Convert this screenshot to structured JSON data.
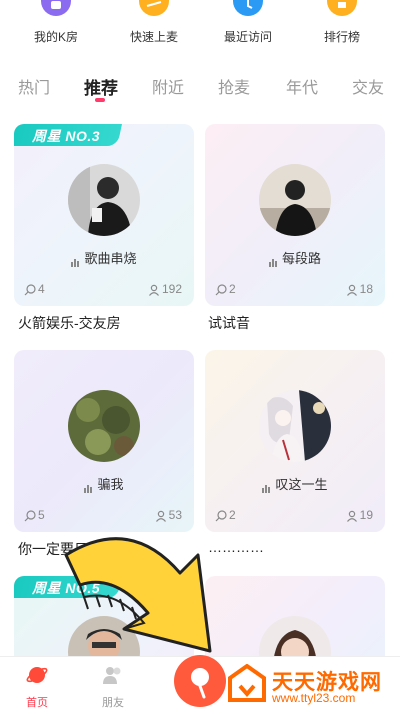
{
  "quick_entries": [
    {
      "label": "我的K房",
      "icon": "my-room-icon",
      "color": "#8b6cf0"
    },
    {
      "label": "快速上麦",
      "icon": "quick-mic-icon",
      "color": "#ffb020"
    },
    {
      "label": "最近访问",
      "icon": "recent-visit-icon",
      "color": "#2b9af5"
    },
    {
      "label": "排行榜",
      "icon": "leaderboard-icon",
      "color": "#ffb020"
    }
  ],
  "tabs": [
    {
      "label": "热门",
      "active": false
    },
    {
      "label": "推荐",
      "active": true
    },
    {
      "label": "附近",
      "active": false
    },
    {
      "label": "抢麦",
      "active": false
    },
    {
      "label": "年代",
      "active": false
    },
    {
      "label": "交友",
      "active": false
    }
  ],
  "rooms": [
    {
      "badge": "周星 NO.3",
      "song": "歌曲串烧",
      "comments": "4",
      "listeners": "192",
      "name": "火箭娱乐-交友房"
    },
    {
      "badge": "",
      "song": "每段路",
      "comments": "2",
      "listeners": "18",
      "name": "试试音"
    },
    {
      "badge": "",
      "song": "骗我",
      "comments": "5",
      "listeners": "53",
      "name": "你一定要日"
    },
    {
      "badge": "",
      "song": "叹这一生",
      "comments": "2",
      "listeners": "19",
      "name": "…………"
    },
    {
      "badge": "周星 NO.5",
      "song": "",
      "comments": "",
      "listeners": "",
      "name": ""
    },
    {
      "badge": "",
      "song": "",
      "comments": "",
      "listeners": "",
      "name": ""
    }
  ],
  "bottom_nav": [
    {
      "label": "首页",
      "icon": "home-planet-icon",
      "active": true
    },
    {
      "label": "朋友",
      "icon": "friends-icon",
      "active": false
    }
  ],
  "watermark": {
    "title": "天天游戏网",
    "url": "www.ttyl23.com"
  },
  "colors": {
    "accent": "#ff3b6b",
    "badge": "#19c9c0",
    "center_button": "#ff5a3c"
  }
}
